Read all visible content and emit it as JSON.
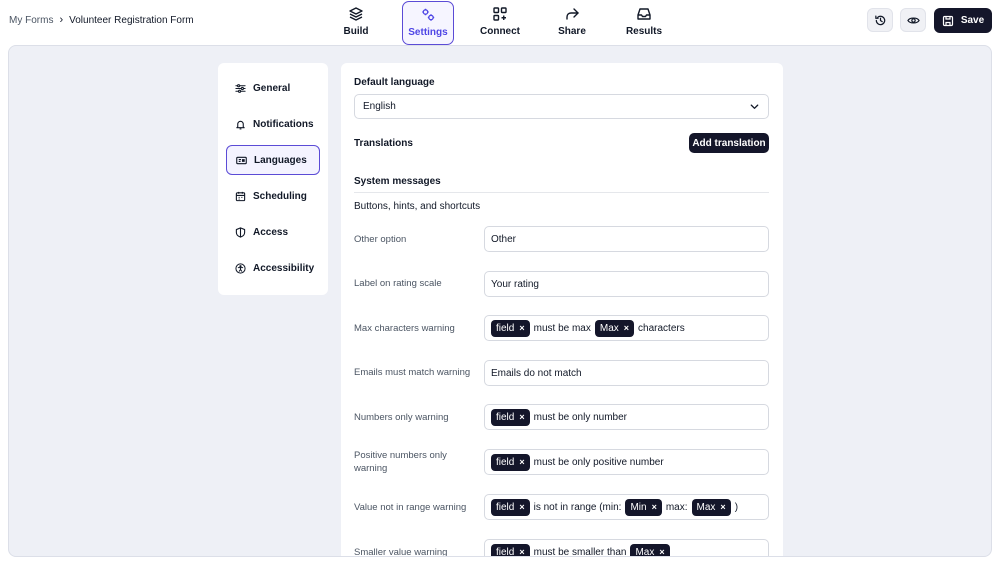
{
  "breadcrumb": {
    "root": "My Forms",
    "separator": "›",
    "current": "Volunteer Registration Form"
  },
  "nav": {
    "build": "Build",
    "settings": "Settings",
    "connect": "Connect",
    "share": "Share",
    "results": "Results"
  },
  "toolbar": {
    "save_label": "Save"
  },
  "sidebar": {
    "items": [
      {
        "label": "General",
        "icon": "sliders-icon"
      },
      {
        "label": "Notifications",
        "icon": "bell-icon"
      },
      {
        "label": "Languages",
        "icon": "language-icon"
      },
      {
        "label": "Scheduling",
        "icon": "calendar-icon"
      },
      {
        "label": "Access",
        "icon": "shield-icon"
      },
      {
        "label": "Accessibility",
        "icon": "accessibility-icon"
      }
    ],
    "active": "Languages"
  },
  "panel": {
    "default_language_label": "Default language",
    "default_language_value": "English",
    "translations_label": "Translations",
    "add_translation_label": "Add translation",
    "system_messages_label": "System messages",
    "section_label": "Buttons, hints, and shortcuts",
    "other_option": {
      "label": "Other option",
      "value": "Other"
    },
    "rating_label": {
      "label": "Label on rating scale",
      "value": "Your rating"
    },
    "max_chars": {
      "label": "Max characters warning",
      "chip1": "field",
      "text1": "must be max",
      "chip2": "Max",
      "text2": "characters"
    },
    "emails_match": {
      "label": "Emails must match warning",
      "value": "Emails do not match"
    },
    "numbers_only": {
      "label": "Numbers only warning",
      "chip1": "field",
      "text1": "must be only number"
    },
    "positive_numbers": {
      "label": "Positive numbers only warning",
      "chip1": "field",
      "text1": "must be only positive number"
    },
    "value_range": {
      "label": "Value not in range warning",
      "chip1": "field",
      "text1": "is not in range (min:",
      "chip2": "Min",
      "text2": "max:",
      "chip3": "Max",
      "text3": ")"
    },
    "smaller_value": {
      "label": "Smaller value warning",
      "chip1": "field",
      "text1": "must be smaller than",
      "chip2": "Max"
    },
    "chip_remove": "×"
  },
  "colors": {
    "accent": "#5b4bd6",
    "dark": "#14162a",
    "canvas": "#eef0f6"
  }
}
